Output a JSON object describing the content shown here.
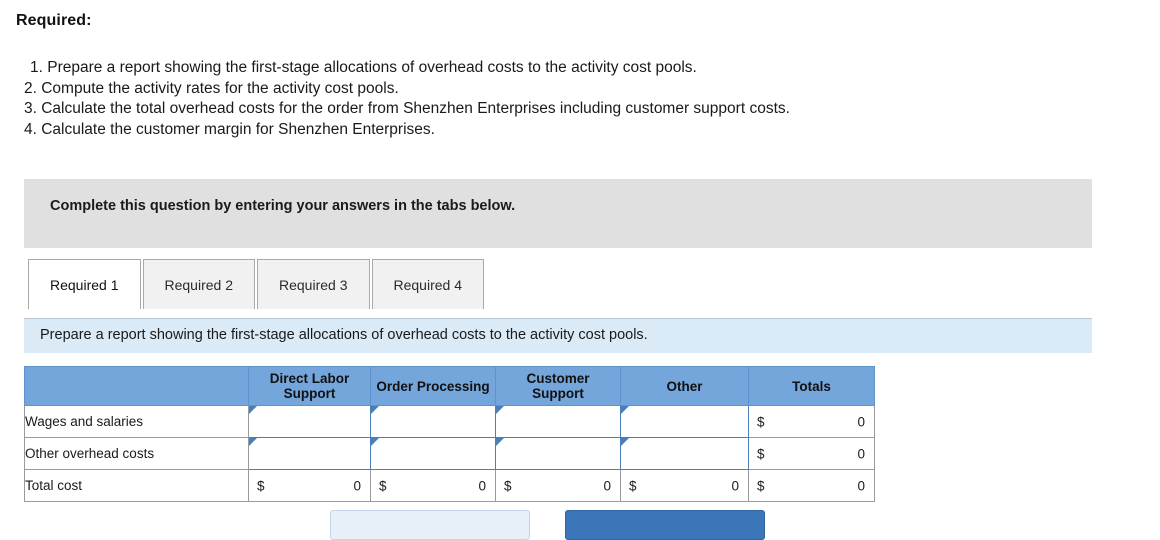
{
  "heading": "Required:",
  "requirements": [
    "1. Prepare a report showing the first-stage allocations of overhead costs to the activity cost pools.",
    "2. Compute the activity rates for the activity cost pools.",
    "3. Calculate the total overhead costs for the order from Shenzhen Enterprises including customer support costs.",
    "4. Calculate the customer margin for Shenzhen Enterprises."
  ],
  "complete_banner": {
    "text": "Complete this question by entering your answers in the tabs below."
  },
  "tabs": [
    {
      "label": "Required 1",
      "active": true
    },
    {
      "label": "Required 2",
      "active": false
    },
    {
      "label": "Required 3",
      "active": false
    },
    {
      "label": "Required 4",
      "active": false
    }
  ],
  "sub_instruction": "Prepare a report showing the first-stage allocations of overhead costs to the activity cost pools.",
  "table": {
    "headers": {
      "label": "",
      "direct_labor_support": "Direct Labor Support",
      "order_processing": "Order Processing",
      "customer_support": "Customer Support",
      "other": "Other",
      "totals": "Totals"
    },
    "rows": [
      {
        "label": "Wages and salaries",
        "direct_labor_support": "",
        "order_processing": "",
        "customer_support": "",
        "other": "",
        "totals_symbol": "$",
        "totals_value": "0"
      },
      {
        "label": "Other overhead costs",
        "direct_labor_support": "",
        "order_processing": "",
        "customer_support": "",
        "other": "",
        "totals_symbol": "$",
        "totals_value": "0"
      }
    ],
    "total_row": {
      "label": "Total cost",
      "cells": [
        {
          "symbol": "$",
          "value": "0"
        },
        {
          "symbol": "$",
          "value": "0"
        },
        {
          "symbol": "$",
          "value": "0"
        },
        {
          "symbol": "$",
          "value": "0"
        },
        {
          "symbol": "$",
          "value": "0"
        }
      ]
    },
    "input_placeholder": ""
  },
  "footer_buttons": {
    "previous": "",
    "next": ""
  },
  "colors": {
    "header_blue": "#74a6db",
    "instruction_blue": "#daeaf7",
    "banner_gray": "#e0e0e0",
    "input_border_blue": "#4a7ebb",
    "primary_button_blue": "#3a76b8"
  }
}
